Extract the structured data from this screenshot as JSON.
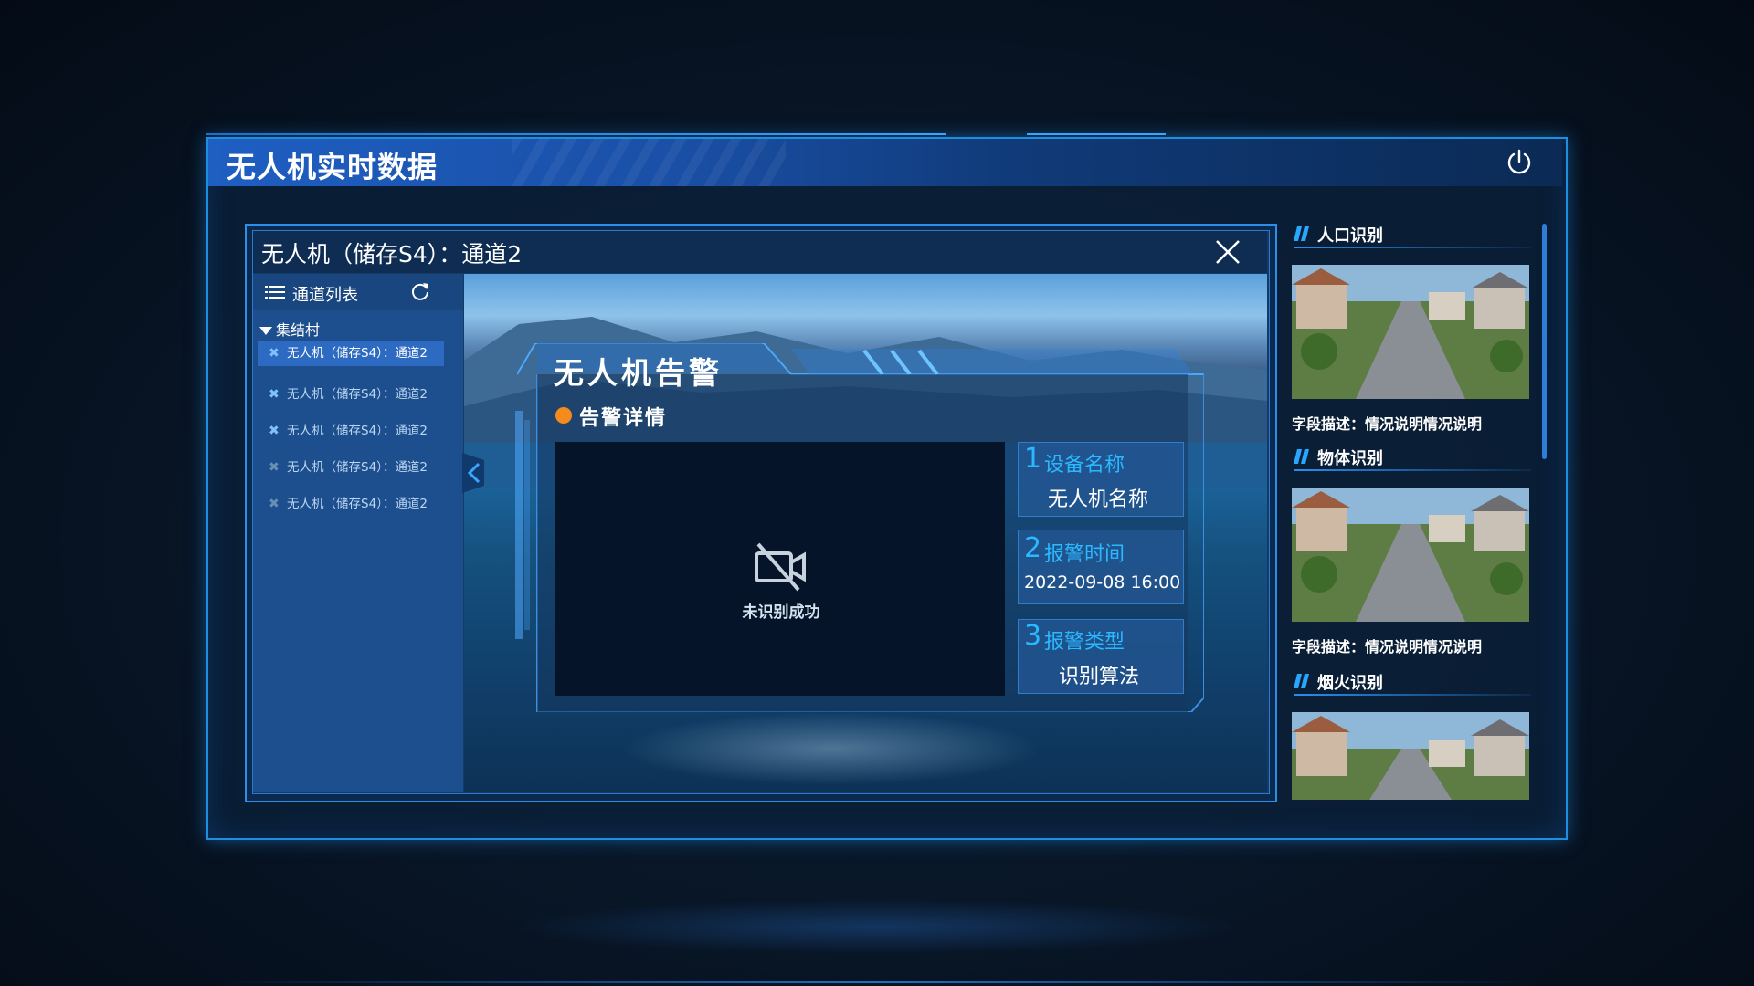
{
  "app": {
    "title": "无人机实时数据"
  },
  "video_window": {
    "title": "无人机（储存S4）：通道2"
  },
  "channel_list": {
    "header_label": "通道列表",
    "group_label": "集结村",
    "items": [
      {
        "label": "无人机（储存S4）：通道2",
        "state": "selected"
      },
      {
        "label": "无人机（储存S4）：通道2",
        "state": "online"
      },
      {
        "label": "无人机（储存S4）：通道2",
        "state": "online"
      },
      {
        "label": "无人机（储存S4）：通道2",
        "state": "offline"
      },
      {
        "label": "无人机（储存S4）：通道2",
        "state": "offline"
      }
    ]
  },
  "alarm": {
    "title": "无人机告警",
    "subtitle": "告警详情",
    "video_status": "未识别成功",
    "fields": [
      {
        "num": "1",
        "label": "设备名称",
        "value": "无人机名称"
      },
      {
        "num": "2",
        "label": "报警时间",
        "value": "2022-09-08 16:00"
      },
      {
        "num": "3",
        "label": "报警类型",
        "value": "识别算法"
      }
    ]
  },
  "recognition": {
    "sections": [
      {
        "title": "人口识别",
        "description": "字段描述：情况说明情况说明"
      },
      {
        "title": "物体识别",
        "description": "字段描述：情况说明情况说明"
      },
      {
        "title": "烟火识别",
        "description": ""
      }
    ]
  },
  "colors": {
    "accent": "#2ab8ff",
    "panel_border": "#1e8fe0",
    "alarm_dot": "#f58a1f",
    "selected_row": "#2d6ac2"
  },
  "icons": {
    "power": "power-icon",
    "close": "close-icon",
    "list": "list-icon",
    "refresh": "refresh-icon",
    "drone": "drone-icon",
    "no_video": "video-off-icon",
    "collapse": "chevron-left-icon"
  }
}
